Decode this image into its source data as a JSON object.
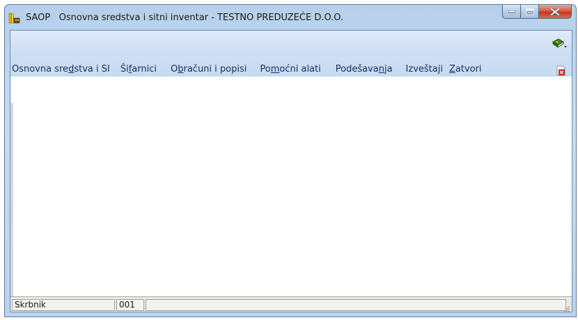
{
  "window": {
    "title": "SAOP   Osnovna sredstva i sitni inventar - TESTNO PREDUZEĆE D.O.O.",
    "app_icon": "saop-books-icon",
    "caption_buttons": [
      "minimize-icon",
      "maximize-icon",
      "close-icon"
    ]
  },
  "menu": {
    "items": [
      {
        "before": "Osnovna sre",
        "mnemonic": "d",
        "after": "stva i SI"
      },
      {
        "before": "Ši",
        "mnemonic": "f",
        "after": "arnici"
      },
      {
        "before": "O",
        "mnemonic": "b",
        "after": "računi i popisi"
      },
      {
        "before": "Po",
        "mnemonic": "m",
        "after": "oćni alati"
      },
      {
        "before": "Podešava",
        "mnemonic": "n",
        "after": "ja"
      },
      {
        "before": "",
        "mnemonic": "",
        "after": "Izveštaji"
      },
      {
        "before": "",
        "mnemonic": "Z",
        "after": "atvori"
      }
    ],
    "help_icon": "help-book-dropdown-icon",
    "close_doc_icon": "close-document-icon"
  },
  "statusbar": {
    "user": "Skrbnik",
    "code": "001",
    "extra": ""
  },
  "colors": {
    "window_frame": "#b6d0ec",
    "menubar": "#cfe0f4",
    "menu_text": "#15305c",
    "close_button": "#c2381f",
    "statusbar": "#ece9e2"
  }
}
